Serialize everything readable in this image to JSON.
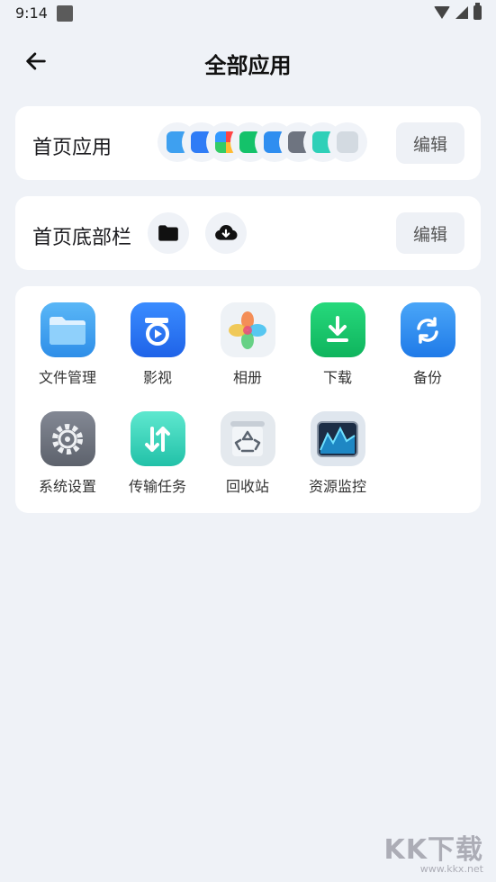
{
  "status": {
    "time": "9:14"
  },
  "header": {
    "title": "全部应用"
  },
  "home_apps": {
    "label": "首页应用",
    "edit_label": "编辑"
  },
  "home_bar": {
    "label": "首页底部栏",
    "edit_label": "编辑"
  },
  "apps": [
    {
      "label": "文件管理",
      "icon": "folder-icon"
    },
    {
      "label": "影视",
      "icon": "video-icon"
    },
    {
      "label": "相册",
      "icon": "photos-icon"
    },
    {
      "label": "下载",
      "icon": "download-icon"
    },
    {
      "label": "备份",
      "icon": "backup-icon"
    },
    {
      "label": "系统设置",
      "icon": "settings-icon"
    },
    {
      "label": "传输任务",
      "icon": "transfer-icon"
    },
    {
      "label": "回收站",
      "icon": "recycle-bin-icon"
    },
    {
      "label": "资源监控",
      "icon": "monitor-icon"
    }
  ],
  "watermark": {
    "big": "KK下载",
    "small": "www.kkx.net"
  },
  "colors": {
    "background": "#eff2f7",
    "card": "#ffffff",
    "folder": "#3ea0f0",
    "video": "#2f7cf6",
    "download": "#14c26a",
    "backup": "#2f8ef0",
    "settings": "#6e7480",
    "transfer": "#2fd0b8",
    "recycle": "#cfd6de",
    "monitor": "#1e3350"
  }
}
